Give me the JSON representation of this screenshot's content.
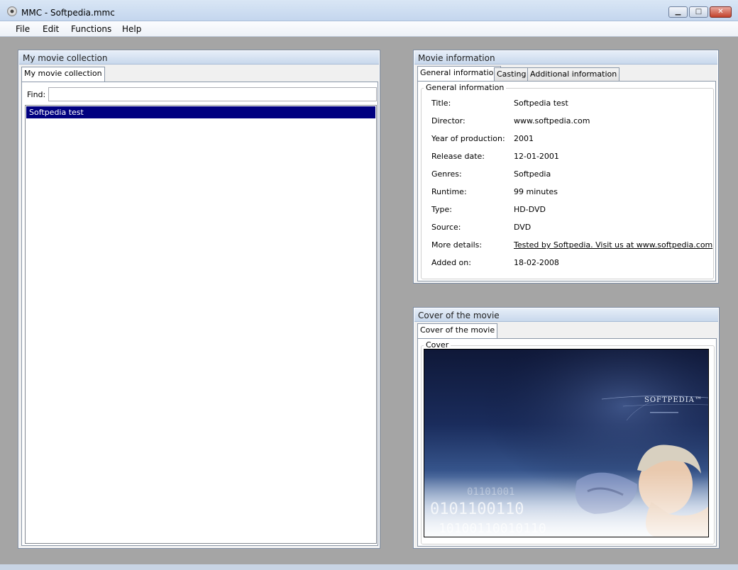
{
  "window": {
    "title": "MMC - Softpedia.mmc",
    "minimize": "▁",
    "maximize": "□",
    "close": "✕"
  },
  "menu": [
    "File",
    "Edit",
    "Functions",
    "Help"
  ],
  "collection": {
    "panel_title": "My movie collection",
    "tab": "My movie collection",
    "find_label": "Find:",
    "find_value": "",
    "items": [
      "Softpedia test"
    ],
    "selected_index": 0
  },
  "info": {
    "panel_title": "Movie information",
    "tabs": [
      "General information",
      "Casting",
      "Additional information"
    ],
    "active_tab": 0,
    "group_title": "General information",
    "fields": [
      {
        "label": "Title:",
        "value": "Softpedia test"
      },
      {
        "label": "Director:",
        "value": "www.softpedia.com"
      },
      {
        "label": "Year of production:",
        "value": "2001"
      },
      {
        "label": "Release date:",
        "value": "12-01-2001"
      },
      {
        "label": "Genres:",
        "value": "Softpedia"
      },
      {
        "label": "Runtime:",
        "value": "99 minutes"
      },
      {
        "label": "Type:",
        "value": "HD-DVD"
      },
      {
        "label": "Source:",
        "value": "DVD"
      },
      {
        "label": "More details:",
        "value": "Tested by Softpedia. Visit us at www.softpedia.com"
      },
      {
        "label": "Added on:",
        "value": "18-02-2008"
      }
    ]
  },
  "cover": {
    "panel_title": "Cover of the movie",
    "tab": "Cover of the movie",
    "group_title": "Cover",
    "image_logo_text": "SOFTPEDIA™"
  },
  "colors": {
    "workspace": "#a5a5a5",
    "selection": "#000080",
    "titlebar": "#c4d6ee"
  }
}
